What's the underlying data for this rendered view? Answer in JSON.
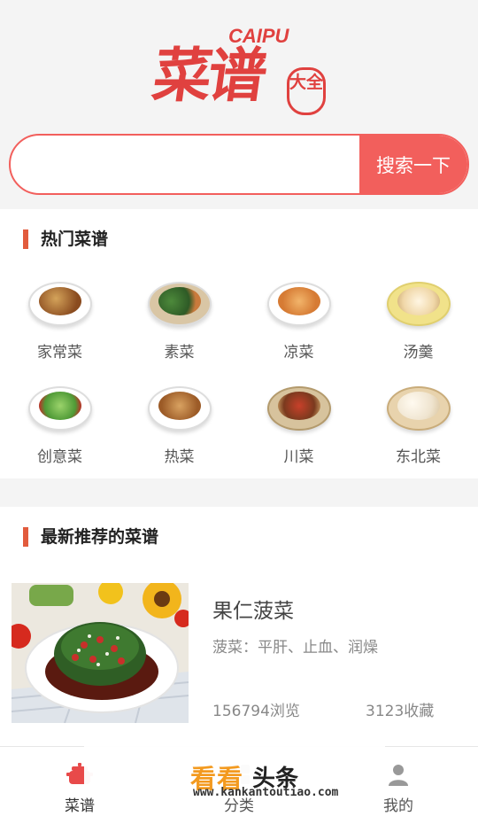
{
  "logo": {
    "text_cn": "菜谱",
    "text_en": "CAIPU",
    "seal": "大全"
  },
  "search": {
    "placeholder": "",
    "button_label": "搜索一下"
  },
  "hot": {
    "title": "热门菜谱",
    "items": [
      {
        "label": "家常菜",
        "icon": "home-dish-icon"
      },
      {
        "label": "素菜",
        "icon": "vegetables-icon"
      },
      {
        "label": "凉菜",
        "icon": "cold-dish-icon"
      },
      {
        "label": "汤羹",
        "icon": "soup-icon"
      },
      {
        "label": "创意菜",
        "icon": "creative-dish-icon"
      },
      {
        "label": "热菜",
        "icon": "hot-dish-icon"
      },
      {
        "label": "川菜",
        "icon": "sichuan-dish-icon"
      },
      {
        "label": "东北菜",
        "icon": "dumpling-icon"
      }
    ]
  },
  "recommend": {
    "title": "最新推荐的菜谱",
    "items": [
      {
        "title": "果仁菠菜",
        "desc": "菠菜：平肝、止血、润燥",
        "views": "156794浏览",
        "favs": "3123收藏"
      }
    ]
  },
  "tabbar": {
    "items": [
      {
        "label": "菜谱",
        "icon": "pot-icon"
      },
      {
        "label": "分类",
        "icon": "category-icon"
      },
      {
        "label": "我的",
        "icon": "user-icon"
      }
    ]
  },
  "watermark": {
    "cn": "看看",
    "cn2": "头条",
    "url": "www.kankantoutiao.com"
  },
  "colors": {
    "accent": "#f25f5c",
    "section_bar": "#e25b3d",
    "logo_red": "#e0413f"
  }
}
